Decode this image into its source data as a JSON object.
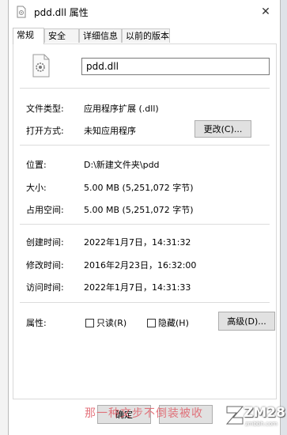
{
  "window": {
    "title": "pdd.dll 属性",
    "close_glyph": "✕"
  },
  "tabs": [
    {
      "label": "常规",
      "active": true
    },
    {
      "label": "安全",
      "active": false
    },
    {
      "label": "详细信息",
      "active": false
    },
    {
      "label": "以前的版本",
      "active": false
    }
  ],
  "general": {
    "file_name": "pdd.dll",
    "file_type_label": "文件类型:",
    "file_type_value": "应用程序扩展 (.dll)",
    "open_with_label": "打开方式:",
    "open_with_value": "未知应用程序",
    "change_button": "更改(C)...",
    "location_label": "位置:",
    "location_value": "D:\\新建文件夹\\pdd",
    "size_label": "大小:",
    "size_value": "5.00 MB (5,251,072 字节)",
    "size_on_disk_label": "占用空间:",
    "size_on_disk_value": "5.00 MB (5,251,072 字节)",
    "created_label": "创建时间:",
    "created_value": "2022年1月7日，14:31:32",
    "modified_label": "修改时间:",
    "modified_value": "2016年2月23日，16:32:00",
    "accessed_label": "访问时间:",
    "accessed_value": "2022年1月7日，14:31:33",
    "attributes_label": "属性:",
    "readonly_label": "只读(R)",
    "hidden_label": "隐藏(H)",
    "advanced_button": "高级(D)..."
  },
  "footer": {
    "ok_button": "确定",
    "watermark": "那一种文步不倒装被收",
    "logo_text": "ZM28",
    "logo_sub": "zmbbh.com"
  },
  "colors": {
    "watermark": "#e0606a",
    "button_face": "#e1e1e1"
  }
}
